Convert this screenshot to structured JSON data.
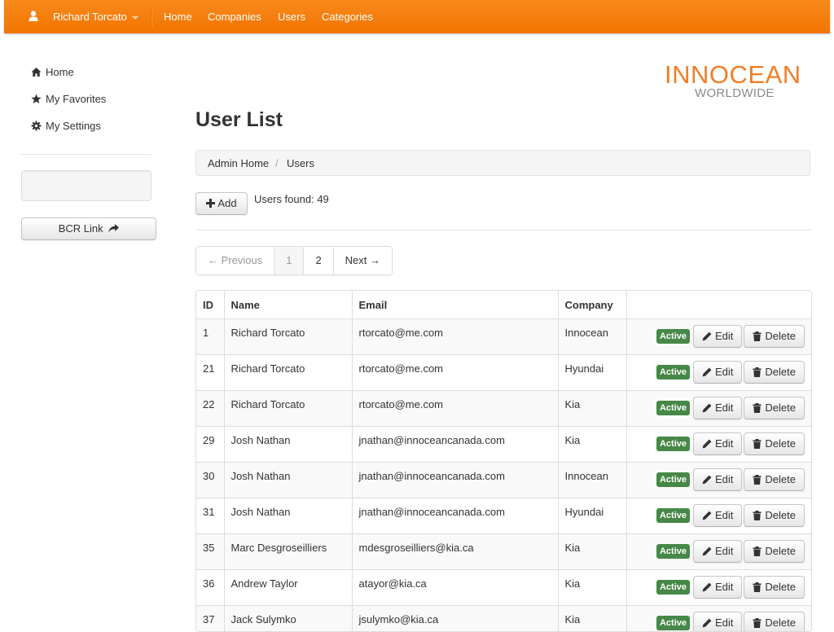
{
  "navbar": {
    "user_name": "Richard Torcato",
    "links": [
      "Home",
      "Companies",
      "Users",
      "Categories"
    ]
  },
  "sidebar": {
    "items": [
      {
        "label": "Home",
        "icon": "home-icon"
      },
      {
        "label": "My Favorites",
        "icon": "star-icon"
      },
      {
        "label": "My Settings",
        "icon": "cog-icon"
      }
    ],
    "bcr_link_label": "BCR Link",
    "bcr_link_icon": "share-arrow-icon"
  },
  "logo": {
    "line1": "INNOCEAN",
    "line2": "WORLDWIDE"
  },
  "page": {
    "title": "User List",
    "breadcrumb": [
      "Admin Home",
      "Users"
    ],
    "breadcrumb_separator": "/",
    "add_label": "Add",
    "users_found": "Users found: 49"
  },
  "pagination": {
    "previous": "← Previous",
    "pages": [
      "1",
      "2"
    ],
    "current_page": "1",
    "next": "Next →"
  },
  "table": {
    "columns": [
      "ID",
      "Name",
      "Email",
      "Company",
      ""
    ],
    "status_label": "Active",
    "edit_label": "Edit",
    "delete_label": "Delete",
    "rows": [
      {
        "id": "1",
        "name": "Richard Torcato",
        "email": "rtorcato@me.com",
        "company": "Innocean"
      },
      {
        "id": "21",
        "name": "Richard Torcato",
        "email": "rtorcato@me.com",
        "company": "Hyundai"
      },
      {
        "id": "22",
        "name": "Richard Torcato",
        "email": "rtorcato@me.com",
        "company": "Kia"
      },
      {
        "id": "29",
        "name": "Josh Nathan",
        "email": "jnathan@innoceancanada.com",
        "company": "Kia"
      },
      {
        "id": "30",
        "name": "Josh Nathan",
        "email": "jnathan@innoceancanada.com",
        "company": "Innocean"
      },
      {
        "id": "31",
        "name": "Josh Nathan",
        "email": "jnathan@innoceancanada.com",
        "company": "Hyundai"
      },
      {
        "id": "35",
        "name": "Marc Desgroseilliers",
        "email": "mdesgroseilliers@kia.ca",
        "company": "Kia"
      },
      {
        "id": "36",
        "name": "Andrew Taylor",
        "email": "atayor@kia.ca",
        "company": "Kia"
      },
      {
        "id": "37",
        "name": "Jack Sulymko",
        "email": "jsulymko@kia.ca",
        "company": "Kia"
      }
    ]
  },
  "colors": {
    "navbar": "#f57c00",
    "logo_orange": "#f07e26",
    "active_badge": "#468847"
  }
}
